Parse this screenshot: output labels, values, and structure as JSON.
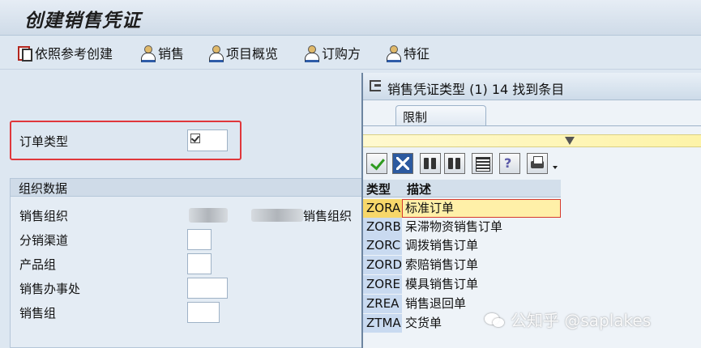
{
  "window": {
    "title": "创建销售凭证"
  },
  "toolbar": {
    "items": [
      {
        "label": "依照参考创建",
        "icon": "copy-reference-icon"
      },
      {
        "label": "销售",
        "icon": "person-icon"
      },
      {
        "label": "项目概览",
        "icon": "person-icon"
      },
      {
        "label": "订购方",
        "icon": "person-icon"
      },
      {
        "label": "特征",
        "icon": "person-icon"
      }
    ]
  },
  "order_type": {
    "label": "订单类型"
  },
  "org_data": {
    "title": "组织数据",
    "fields": [
      {
        "label": "销售组织",
        "suffix": "销售组织"
      },
      {
        "label": "分销渠道"
      },
      {
        "label": "产品组"
      },
      {
        "label": "销售办事处"
      },
      {
        "label": "销售组"
      }
    ]
  },
  "popup": {
    "title": "销售凭证类型 (1)    14 找到条目",
    "tab": "限制",
    "columns": {
      "code": "类型",
      "desc": "描述"
    },
    "rows": [
      {
        "code": "ZORA",
        "desc": "标准订单"
      },
      {
        "code": "ZORB",
        "desc": "呆滞物资销售订单"
      },
      {
        "code": "ZORC",
        "desc": "调拨销售订单"
      },
      {
        "code": "ZORD",
        "desc": "索赔销售订单"
      },
      {
        "code": "ZORE",
        "desc": "模具销售订单"
      },
      {
        "code": "ZREA",
        "desc": "销售退回单"
      },
      {
        "code": "ZTMA",
        "desc": "交货单"
      }
    ],
    "selected_index": 0
  },
  "watermark": {
    "text": "公知乎 @saplakes"
  },
  "colors": {
    "accent_red": "#e0373b",
    "selection": "#fff0a8",
    "code_bg": "#c9daf0"
  }
}
